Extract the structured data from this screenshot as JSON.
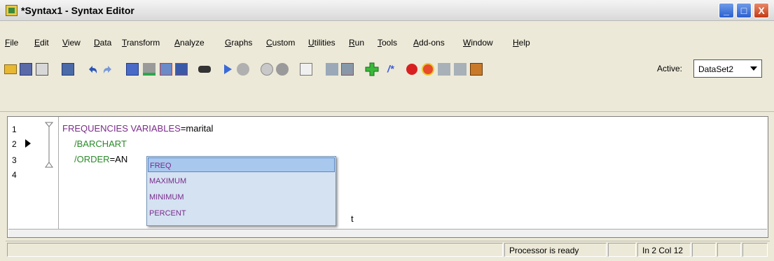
{
  "window": {
    "title": "*Syntax1 - Syntax Editor",
    "controls": {
      "minimize": "_",
      "maximize": "□",
      "close": "X"
    }
  },
  "menubar": {
    "items": [
      "File",
      "Edit",
      "View",
      "Data",
      "Transform",
      "Analyze",
      "Graphs",
      "Custom",
      "Utilities",
      "Run",
      "Tools",
      "Add-ons",
      "Window",
      "Help"
    ]
  },
  "toolbar": {
    "active_label": "Active:",
    "dataset_value": "DataSet2",
    "icons": [
      "open-icon",
      "save-icon",
      "print-icon",
      "dialog-recall-icon",
      "undo-icon",
      "redo-icon",
      "goto-case-icon",
      "goto-variable-icon",
      "variables-icon",
      "run-descriptives-icon",
      "find-icon",
      "run-selection-icon",
      "step-icon",
      "run-to-end-icon",
      "run-all-icon",
      "wrap-icon",
      "toggle-comment-icon",
      "collapse-icon",
      "add-icon",
      "comment-icon",
      "breakpoint-icon",
      "spell-check-icon",
      "bookmark-icon",
      "bookmark-prev-icon",
      "bookmark-next-icon"
    ]
  },
  "editor": {
    "line_numbers": [
      "1",
      "2",
      "3",
      "4"
    ],
    "lines": {
      "l1_keyword": "FREQUENCIES VARIABLES",
      "l1_rest": "=marital",
      "l2": "/BARCHART",
      "l3_sub": "/ORDER",
      "l3_rest": "=AN"
    },
    "partial_hidden_text": "t",
    "autocomplete": {
      "options": [
        "FREQ",
        "MAXIMUM",
        "MINIMUM",
        "PERCENT"
      ],
      "selected_index": 0
    }
  },
  "statusbar": {
    "processor": "Processor is ready",
    "position": "In 2 Col 12"
  },
  "colors": {
    "keyword": "#7a2b8a",
    "subcommand": "#2a8a2a",
    "popup_bg": "#d4e2f2",
    "popup_selected": "#a8c8ee"
  }
}
